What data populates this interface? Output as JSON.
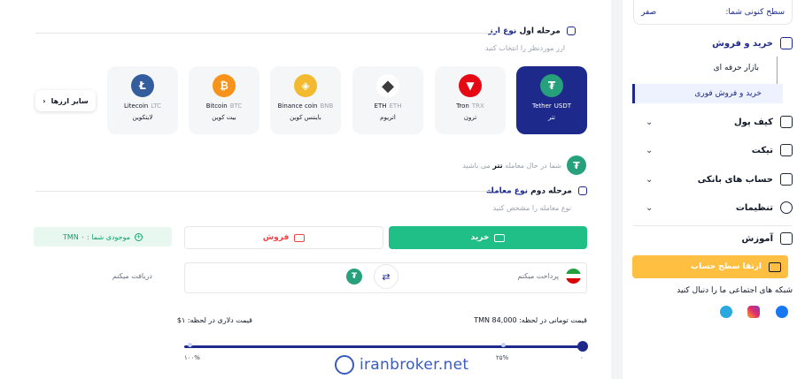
{
  "sidebar": {
    "level_label": "سطح کنونی شما:",
    "level_value": "صفر",
    "menu": {
      "trade": "خرید و فروش",
      "pro_market": "بازار حرفه ای",
      "instant_trade": "خرید و فروش فوری",
      "wallet": "کیف پول",
      "ticket": "تیکت",
      "bank_accounts": "حساب های بانکی",
      "settings": "تنظیمات",
      "learning": "آموزش"
    },
    "upgrade_label": "ارتقا سطح حساب",
    "follow_text": "شبکه های اجتماعی ما را دنبال کنید"
  },
  "step1": {
    "title_prefix": "مرحله اول",
    "title_highlight": "نوع ارز",
    "subtitle": "ارز موردنظر را انتخاب کنید"
  },
  "coins": [
    {
      "name": "Tether",
      "symbol": "USDT",
      "fa": "تتر",
      "glyph": "₮",
      "color": "#26a17b"
    },
    {
      "name": "Tron",
      "symbol": "TRX",
      "fa": "ترون",
      "glyph": "▼",
      "color": "#e50914"
    },
    {
      "name": "ETH",
      "symbol": "ETH",
      "fa": "اتریوم",
      "glyph": "◆",
      "color": "#3c3c3d"
    },
    {
      "name": "Binance coin",
      "symbol": "BNB",
      "fa": "بایننس کوین",
      "glyph": "◈",
      "color": "#f3ba2f"
    },
    {
      "name": "Bitcoin",
      "symbol": "BTC",
      "fa": "بیت کوین",
      "glyph": "₿",
      "color": "#f7931a"
    },
    {
      "name": "Litecoin",
      "symbol": "LTC",
      "fa": "لایتکوین",
      "glyph": "Ł",
      "color": "#345d9d"
    }
  ],
  "other_coins": "سایر ارزها",
  "trading_note": {
    "prefix": "شما در حال معامله",
    "coin": "تتر",
    "suffix": "می باشید"
  },
  "step2": {
    "title_prefix": "مرحله دوم",
    "title_highlight": "نوع معامله",
    "subtitle": "نوع معامله را مشخص کنید"
  },
  "balance": "موجودی شما : TMN ۰",
  "buy_label": "خرید",
  "sell_label": "فروش",
  "pay_label": "پرداخت میکنم",
  "receive_label": "دریافت میکنم",
  "toman_price": "قیمت تومانی در لحظه: TMN 84,000",
  "dollar_price": "قیمت دلاری در لحظه: ۱$",
  "slider": {
    "value_percent": 0,
    "labels": [
      "۰",
      "۲۵%",
      "۱۰۰%"
    ]
  },
  "watermark": "iranbroker.net"
}
